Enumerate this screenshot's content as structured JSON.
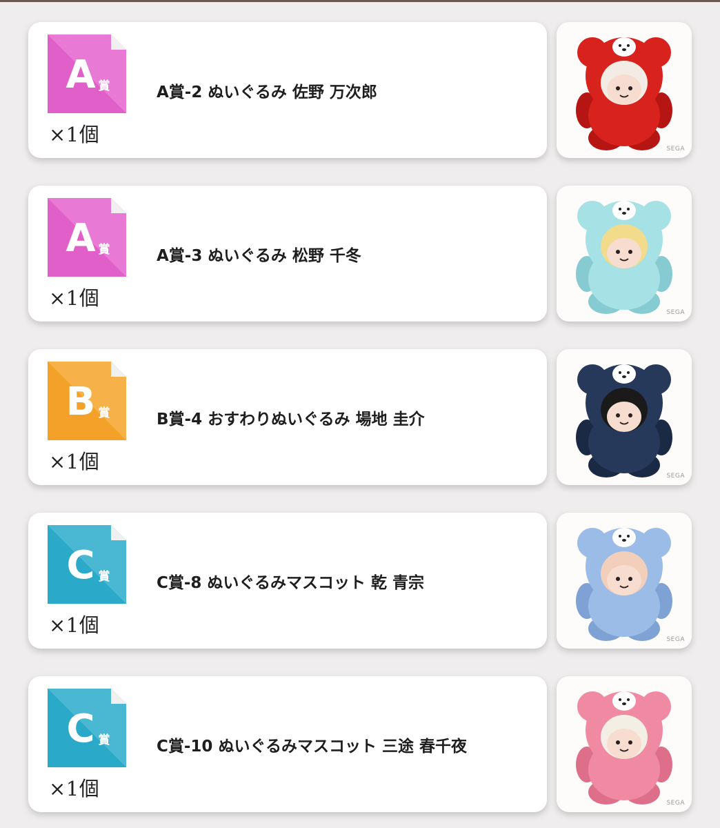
{
  "items": [
    {
      "tier": "A",
      "tier_suffix": "賞",
      "badge_color": "#e05fc8",
      "badge_light": "#ee8fe0",
      "quantity": "×1個",
      "name": "A賞-2 ぬいぐるみ 佐野 万次郎",
      "thumb_icon": "red-bear-plush-icon",
      "plush_color": "#d8221e",
      "plush_dark": "#b51613",
      "hair_color": "#f3ece4",
      "watermark": "SEGA"
    },
    {
      "tier": "A",
      "tier_suffix": "賞",
      "badge_color": "#e05fc8",
      "badge_light": "#ee8fe0",
      "quantity": "×1個",
      "name": "A賞-3 ぬいぐるみ 松野 千冬",
      "thumb_icon": "mint-bear-plush-icon",
      "plush_color": "#a6e1e6",
      "plush_dark": "#86cbd2",
      "hair_color": "#f2dc8c",
      "watermark": "SEGA"
    },
    {
      "tier": "B",
      "tier_suffix": "賞",
      "badge_color": "#f4a12a",
      "badge_light": "#f8bf63",
      "quantity": "×1個",
      "name": "B賞-4 おすわりぬいぐるみ 場地 圭介",
      "thumb_icon": "navy-bear-plush-icon",
      "plush_color": "#27395a",
      "plush_dark": "#1b2a44",
      "hair_color": "#1a1a1a",
      "watermark": "SEGA"
    },
    {
      "tier": "C",
      "tier_suffix": "賞",
      "badge_color": "#2aa9c8",
      "badge_light": "#64c4da",
      "quantity": "×1個",
      "name": "C賞-8 ぬいぐるみマスコット 乾 青宗",
      "thumb_icon": "blue-bear-plush-icon",
      "plush_color": "#9bbce6",
      "plush_dark": "#7ea2d4",
      "hair_color": "#f2cfba",
      "watermark": "SEGA"
    },
    {
      "tier": "C",
      "tier_suffix": "賞",
      "badge_color": "#2aa9c8",
      "badge_light": "#64c4da",
      "quantity": "×1個",
      "name": "C賞-10 ぬいぐるみマスコット 三途 春千夜",
      "thumb_icon": "pink-bear-plush-icon",
      "plush_color": "#f08aa2",
      "plush_dark": "#de6f8a",
      "hair_color": "#f4efe4",
      "watermark": "SEGA"
    }
  ]
}
